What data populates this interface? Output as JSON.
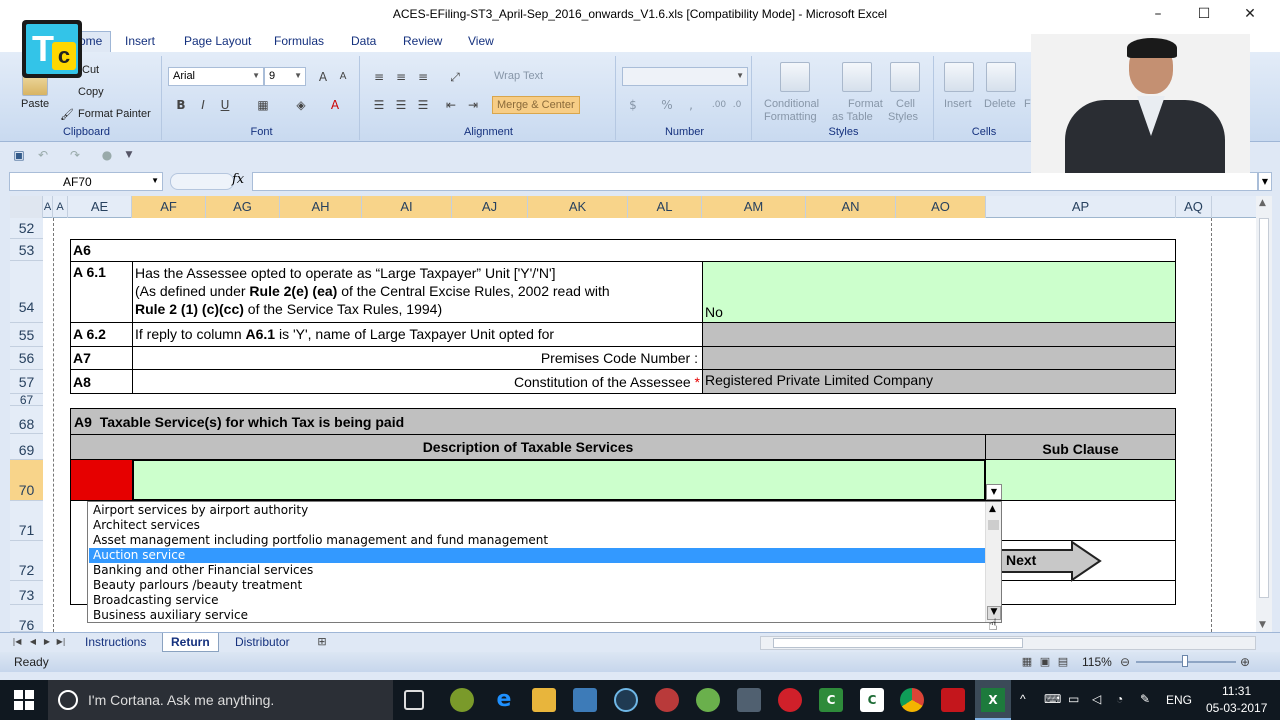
{
  "window": {
    "title": "ACES-EFiling-ST3_April-Sep_2016_onwards_V1.6.xls  [Compatibility Mode] - Microsoft Excel",
    "minimize": "–",
    "maximize": "☐",
    "close": "✕"
  },
  "ribbon_tabs": [
    "ome",
    "Insert",
    "Page Layout",
    "Formulas",
    "Data",
    "Review",
    "View"
  ],
  "clipboard": {
    "paste": "Paste",
    "cut": "Cut",
    "copy": "Copy",
    "format_painter": "Format Painter",
    "label": "Clipboard"
  },
  "font": {
    "name": "Arial",
    "size": "9",
    "bold": "B",
    "italic": "I",
    "underline": "U",
    "label": "Font"
  },
  "alignment": {
    "wrap": "Wrap Text",
    "merge": "Merge & Center",
    "label": "Alignment"
  },
  "number": {
    "format": "",
    "percent": "%",
    "comma": ",",
    "label": "Number"
  },
  "styles": {
    "conditional": "Conditional",
    "formatting": "Formatting",
    "format_as": "Format",
    "as_table": "as Table",
    "cell": "Cell",
    "cell_styles": "Styles",
    "label": "Styles"
  },
  "cells": {
    "insert": "Insert",
    "delete": "Delete",
    "format": "F",
    "label": "Cells"
  },
  "formula_bar": {
    "name_box": "AF70",
    "fx": "fx",
    "value": ""
  },
  "columns": [
    "A",
    "A",
    "AE",
    "AF",
    "AG",
    "AH",
    "AI",
    "AJ",
    "AK",
    "AL",
    "AM",
    "AN",
    "AO",
    "AP",
    "AQ"
  ],
  "rows": [
    "52",
    "53",
    "54",
    "55",
    "56",
    "57",
    "67",
    "68",
    "69",
    "70",
    "71",
    "72",
    "73",
    "76"
  ],
  "sheet": {
    "a6": "A6",
    "a61": "A 6.1",
    "a61_line1": "Has the Assessee opted to operate as “Large Taxpayer” Unit ['Y'/'N']",
    "a61_line2a": "(As defined under ",
    "a61_line2b": "Rule 2(e) (ea)",
    "a61_line2c": " of the Central Excise Rules, 2002 read with",
    "a61_line3a": "Rule 2 (1) (c)(cc)",
    "a61_line3b": " of the Service Tax Rules, 1994)",
    "a61_value": "No",
    "a62": "A 6.2",
    "a62_text_a": "If reply to column ",
    "a62_text_b": "A6.1",
    "a62_text_c": " is 'Y', name of Large Taxpayer Unit opted for",
    "a7": "A7",
    "a7_text": "Premises Code Number :",
    "a8": "A8",
    "a8_text": "Constitution of the Assessee",
    "a8_star": "*",
    "a8_value": "Registered Private Limited Company",
    "a9": "A9",
    "a9_text": "Taxable Service(s) for which Tax is being paid",
    "desc_header": "Description of Taxable Services",
    "subclause_header": "Sub Clause",
    "next": "Next"
  },
  "dropdown": {
    "options": [
      "Airport services by airport authority",
      "Architect services",
      "Asset management including portfolio management and fund management",
      "Auction service",
      "Banking and other Financial services",
      "Beauty parlours /beauty treatment",
      "Broadcasting service",
      "Business auxiliary service"
    ],
    "selected_index": 3
  },
  "sheet_tabs": [
    "Instructions",
    "Return",
    "Distributor"
  ],
  "status": {
    "ready": "Ready",
    "zoom": "115%"
  },
  "taskbar": {
    "search": "I'm Cortana. Ask me anything.",
    "lang": "ENG",
    "time": "11:31",
    "date": "05-03-2017"
  },
  "colors": {
    "accent": "#f8d48a",
    "green": "#ccffcc",
    "grey": "#c0c0c0",
    "selection": "#3399ff",
    "red": "#e60000"
  }
}
